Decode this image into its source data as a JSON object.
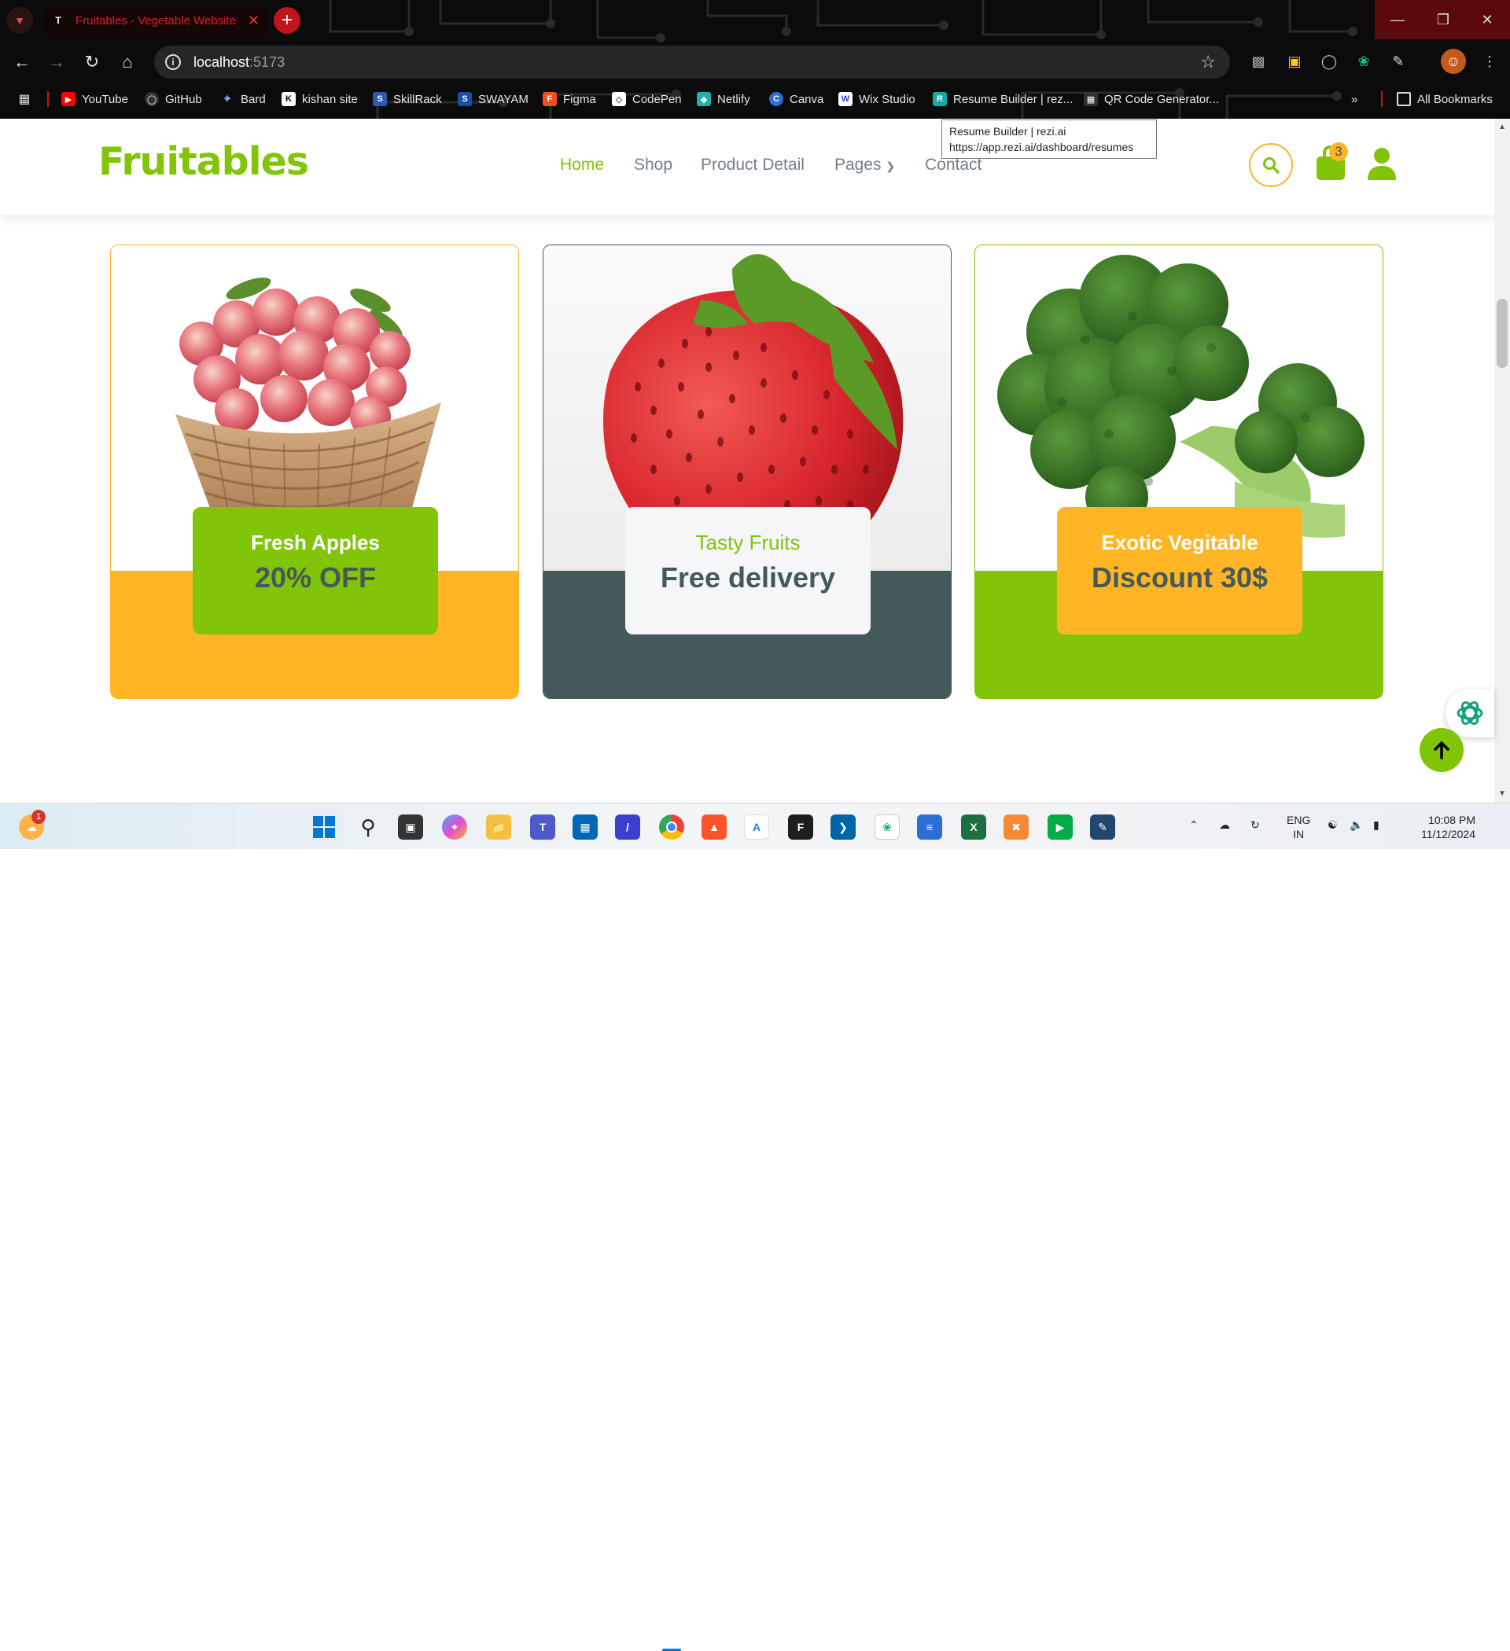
{
  "browser": {
    "tab_title": "Fruitables - Vegetable Website",
    "url_host": "localhost",
    "url_port": ":5173",
    "bookmarks": [
      "YouTube",
      "GitHub",
      "Bard",
      "kishan site",
      "SkillRack",
      "SWAYAM",
      "Figma",
      "CodePen",
      "Netlify",
      "Canva",
      "Wix Studio",
      "Resume Builder | rez...",
      "QR Code Generator..."
    ],
    "all_bookmarks": "All Bookmarks",
    "tooltip": {
      "line1": "Resume Builder | rezi.ai",
      "line2": "https://app.rezi.ai/dashboard/resumes"
    }
  },
  "site": {
    "logo": "Fruitables",
    "nav": [
      "Home",
      "Shop",
      "Product Detail",
      "Pages",
      "Contact"
    ],
    "cart_count": "3",
    "colors": {
      "primary": "#81c408",
      "secondary": "#ffb524",
      "dark": "#45595b"
    }
  },
  "banners": [
    {
      "title": "Fresh Apples",
      "subtitle": "20% OFF",
      "icon": "apple-basket"
    },
    {
      "title": "Tasty Fruits",
      "subtitle": "Free delivery",
      "icon": "strawberry"
    },
    {
      "title": "Exotic Vegitable",
      "subtitle": "Discount 30$",
      "icon": "broccoli"
    }
  ],
  "taskbar": {
    "weather_badge": "1",
    "lang": "ENG",
    "region": "IN",
    "time": "10:08 PM",
    "date": "11/12/2024"
  }
}
